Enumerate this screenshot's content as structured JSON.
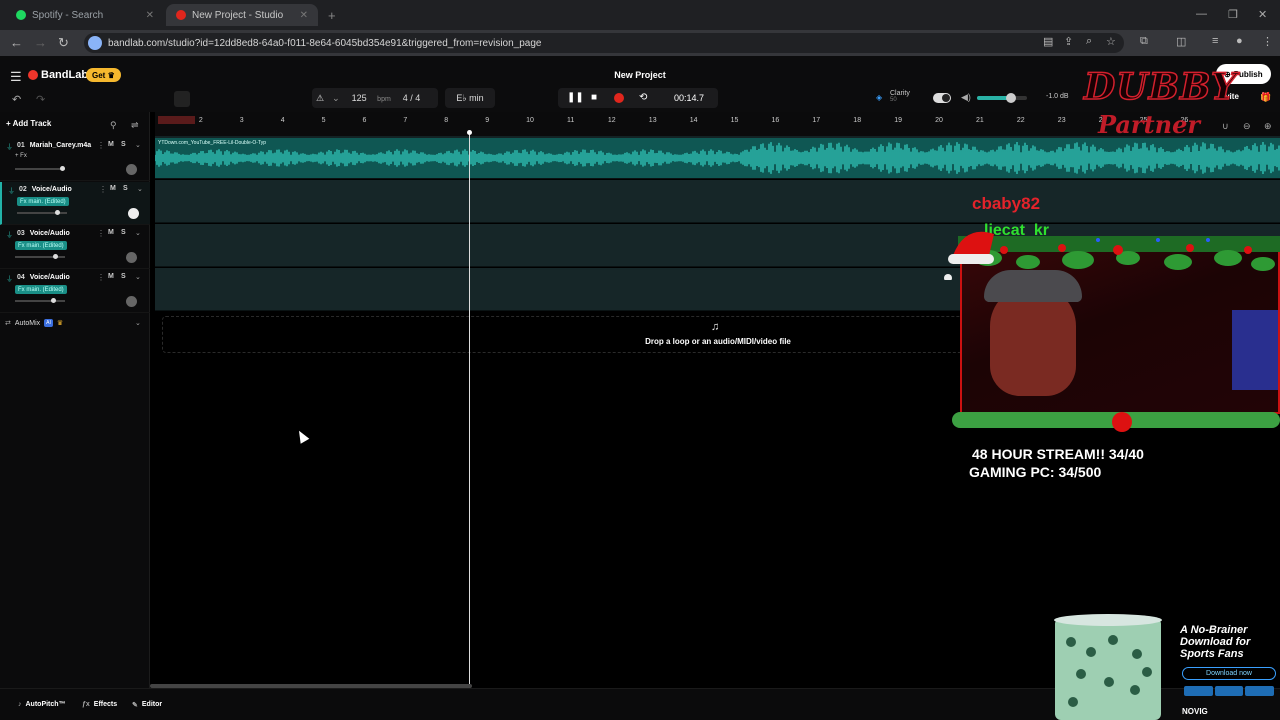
{
  "browser": {
    "tabs": [
      {
        "title": "Spotify - Search",
        "favicon_color": "#1ed760"
      },
      {
        "title": "New Project - Studio",
        "favicon_color": "#e0261d"
      }
    ],
    "url": "bandlab.com/studio?id=12dd8ed8-64a0-f011-8e64-6045bd354e91&triggered_from=revision_page"
  },
  "header": {
    "brand": "BandLab",
    "get_label": "Get",
    "project_title": "New Project",
    "bpm": "125",
    "bpm_unit": "bpm",
    "time_signature": "4 / 4",
    "key": "E♭ min",
    "time": "00:14.7",
    "clarity_label": "Clarity",
    "clarity_value": "50",
    "master_db": "-1.0 dB",
    "publish_label": "Publish",
    "invite_label": "Invite",
    "master_volume": 0.62
  },
  "panel": {
    "add_track_label": "Add Track",
    "automix_label": "AutoMix",
    "ai_badge": "AI"
  },
  "tracks": [
    {
      "num": "01",
      "name": "Mariah_Carey.m4a",
      "fx": "+ Fx",
      "fx_pill": false,
      "mute": "M",
      "solo": "S",
      "volume": 0.95,
      "selected": false
    },
    {
      "num": "02",
      "name": "Voice/Audio",
      "fx": "Fx main. (Edited)",
      "fx_pill": true,
      "mute": "M",
      "solo": "S",
      "volume": 0.82,
      "selected": true
    },
    {
      "num": "03",
      "name": "Voice/Audio",
      "fx": "Fx main. (Edited)",
      "fx_pill": true,
      "mute": "M",
      "solo": "S",
      "volume": 0.82,
      "selected": false
    },
    {
      "num": "04",
      "name": "Voice/Audio",
      "fx": "Fx main. (Edited)",
      "fx_pill": true,
      "mute": "M",
      "solo": "S",
      "volume": 0.78,
      "selected": false
    }
  ],
  "timeline": {
    "bars": [
      "1",
      "2",
      "3",
      "4",
      "5",
      "6",
      "7",
      "8",
      "9",
      "10",
      "11",
      "12",
      "13",
      "14",
      "15",
      "16",
      "17",
      "18",
      "19",
      "20",
      "21",
      "22",
      "23",
      "24",
      "25",
      "26"
    ],
    "clip_title": "YTDown.com_YouTube_FREE-Lil-Double-O-Typ",
    "drop_text": "Drop a loop or an audio/MIDI/video file"
  },
  "bottom": {
    "autopitch": "AutoPitch™",
    "effects": "Effects",
    "editor": "Editor"
  },
  "overlay": {
    "logo_line1": "DUBBY",
    "logo_line2": "Partner",
    "chat_user1": "cbaby82",
    "chat_user2": "liecat_kr",
    "stream_line1": "48 HOUR STREAM!! 34/40",
    "stream_line2": "GAMING PC: 34/500",
    "ad_headline": "A No-Brainer Download for Sports Fans",
    "ad_cta": "Download now",
    "ad_brand": "NOVIG"
  },
  "colors": {
    "accent": "#22b3a8",
    "record": "#e0261d",
    "get_badge": "#f5b82e",
    "clip": "#0f5753"
  }
}
